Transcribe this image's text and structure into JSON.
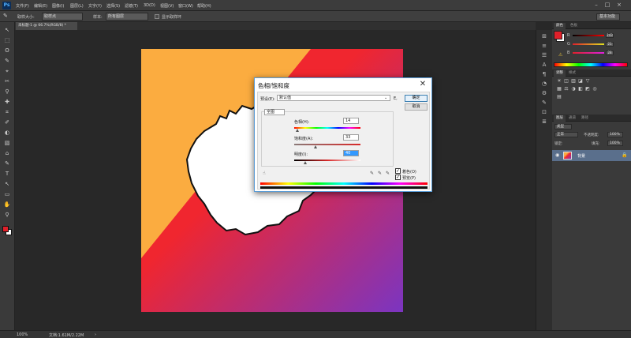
{
  "app": {
    "logo": "Ps"
  },
  "menu": {
    "items": [
      "文件(F)",
      "编辑(E)",
      "图像(I)",
      "图层(L)",
      "文字(Y)",
      "选择(S)",
      "滤镜(T)",
      "3D(D)",
      "视图(V)",
      "窗口(W)",
      "帮助(H)"
    ],
    "window_buttons": [
      "–",
      "□",
      "×"
    ]
  },
  "options_bar": {
    "sample_size_label": "取样大小:",
    "sample_size_value": "取样点",
    "sample_label": "样本:",
    "sample_value": "所有图层",
    "show_ring_label": "显示取样环",
    "workspace": "基本功能"
  },
  "document": {
    "tab_label": "未标题-1 @ 66.7%(RGB/8) *"
  },
  "status": {
    "zoom": "100%",
    "doc_info": "文档:1.61M/2.22M",
    "arrow": "›"
  },
  "tools": [
    "↖",
    "⬚",
    "ʘ",
    "✎",
    "⌖",
    "✂",
    "⚲",
    "✚",
    "⌗",
    "✐",
    "◐",
    "▧",
    "⌂",
    "✎",
    "T",
    "↖",
    "▭",
    "✋",
    "⚲"
  ],
  "strip_icons": [
    "⊞",
    "≡",
    "☰",
    "A",
    "¶",
    "◔",
    "⚙",
    "✎",
    "⊡",
    "≣"
  ],
  "colors": {
    "canvas_top_left": "#fbac40",
    "canvas_red": "#f0262f",
    "canvas_purple": "#7b35c1",
    "foreground": "#e0202a",
    "background": "#ffffff",
    "accent": "#5a9bd5"
  },
  "panels": {
    "color_tabs": [
      "颜色",
      "色板"
    ],
    "adjust_tabs": [
      "调整",
      "样式"
    ],
    "layers_tabs": [
      "图层",
      "通道",
      "路径"
    ],
    "sliders": [
      {
        "label": "R",
        "value": "243"
      },
      {
        "label": "G",
        "value": "21"
      },
      {
        "label": "B",
        "value": "28"
      }
    ],
    "adjust_icons": [
      "☀",
      "◫",
      "▥",
      "◪",
      "▽",
      "▦",
      "⚖",
      "◑",
      "◧",
      "◩",
      "◎",
      "▤"
    ],
    "layers": {
      "kind_label": "类型",
      "blend_mode": "正常",
      "opacity_label": "不透明度:",
      "opacity_value": "100%",
      "lock_label": "锁定:",
      "fill_label": "填充:",
      "fill_value": "100%",
      "layer_name": "背景"
    }
  },
  "dialog": {
    "title": "色相/饱和度",
    "close": "✕",
    "preset_label": "预设(E):",
    "preset_value": "默认值",
    "preset_menu_icon": "E,",
    "channel_value": "全图",
    "hue_label": "色相(H):",
    "hue_value": "14",
    "saturation_label": "饱和度(A):",
    "saturation_value": "33",
    "lightness_label": "明度(I):",
    "lightness_value": "40",
    "ok_label": "确定",
    "cancel_label": "取消",
    "colorize_label": "着色(O)",
    "preview_label": "预览(P)",
    "colorize_checked": true,
    "preview_checked": true
  }
}
